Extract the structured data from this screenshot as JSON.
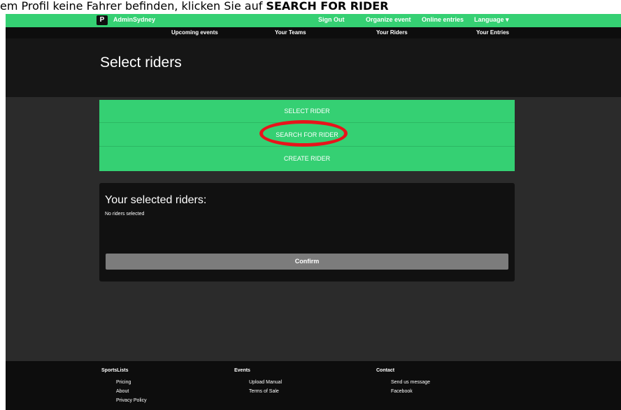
{
  "caption": {
    "prefix": "em Profil keine Fahrer befinden, klicken Sie auf ",
    "bold": "SEARCH FOR RIDER"
  },
  "topbar": {
    "logo_letter": "P",
    "username": "AdminSydney",
    "links": [
      "Sign Out",
      "Organize event",
      "Online entries",
      "Language"
    ],
    "language_caret": "▾"
  },
  "subnav": [
    "Upcoming events",
    "Your Teams",
    "Your Riders",
    "Your Entries"
  ],
  "page_title": "Select riders",
  "actions": [
    "SELECT RIDER",
    "SEARCH FOR RIDER",
    "CREATE RIDER"
  ],
  "selected": {
    "heading": "Your selected riders:",
    "empty_text": "No riders selected",
    "confirm_label": "Confirm"
  },
  "footer": {
    "col1": {
      "title": "SportsLists",
      "links": [
        "Pricing",
        "About",
        "Privacy Policy"
      ]
    },
    "col2": {
      "title": "Events",
      "links": [
        "Upload Manual",
        "Terms of Sale"
      ]
    },
    "col3": {
      "title": "Contact",
      "links": [
        "Send us message",
        "Facebook"
      ]
    }
  },
  "colors": {
    "green": "#35d073",
    "dark": "#111111",
    "highlight": "#e8141b"
  }
}
